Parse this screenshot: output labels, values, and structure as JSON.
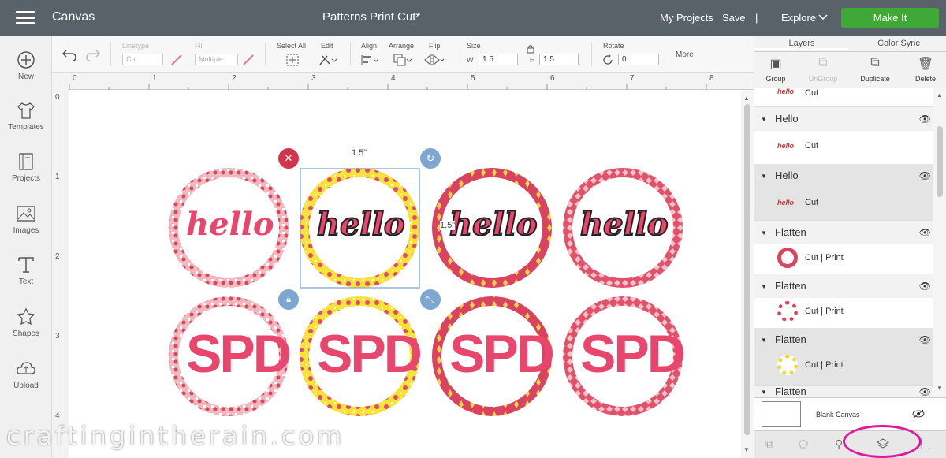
{
  "header": {
    "app_title": "Canvas",
    "doc_title": "Patterns Print Cut*",
    "my_projects": "My Projects",
    "save": "Save",
    "divider": "|",
    "explore": "Explore",
    "make_it": "Make It"
  },
  "leftbar": {
    "items": [
      {
        "label": "New",
        "icon": "plus-circle-icon"
      },
      {
        "label": "Templates",
        "icon": "tshirt-icon"
      },
      {
        "label": "Projects",
        "icon": "projects-icon"
      },
      {
        "label": "Images",
        "icon": "image-icon"
      },
      {
        "label": "Text",
        "icon": "text-icon"
      },
      {
        "label": "Shapes",
        "icon": "shapes-icon"
      },
      {
        "label": "Upload",
        "icon": "upload-icon"
      }
    ]
  },
  "toolbar": {
    "linetype_label": "Linetype",
    "linetype_value": "Cut",
    "fill_label": "Fill",
    "fill_value": "Multiple",
    "select_all": "Select All",
    "edit": "Edit",
    "align": "Align",
    "arrange": "Arrange",
    "flip": "Flip",
    "size": "Size",
    "w_label": "W",
    "w_value": "1.5",
    "h_label": "H",
    "h_value": "1.5",
    "rotate": "Rotate",
    "rotate_value": "0",
    "more": "More"
  },
  "ruler": {
    "h": [
      "0",
      "1",
      "2",
      "3",
      "4",
      "5",
      "6",
      "7",
      "8"
    ],
    "v": [
      "0",
      "1",
      "2",
      "3",
      "4"
    ]
  },
  "canvas": {
    "size_top": "1.5\"",
    "size_side": "1.5\"",
    "top_row_text": "hello",
    "bottom_row_text": "SPD",
    "watermark": "craftingintherain.com"
  },
  "layers_panel": {
    "tab_layers": "Layers",
    "tab_color_sync": "Color Sync",
    "group": "Group",
    "ungroup": "UnGroup",
    "duplicate": "Duplicate",
    "delete": "Delete",
    "partial_top": "Cut",
    "layers": [
      {
        "name": "Hello",
        "sub": "Cut",
        "thumb": "hello"
      },
      {
        "name": "Hello",
        "sub": "Cut",
        "thumb": "hello"
      },
      {
        "name": "Flatten",
        "sub": "Cut  |  Print"
      },
      {
        "name": "Flatten",
        "sub": "Cut  |  Print"
      },
      {
        "name": "Flatten",
        "sub": "Cut  |  Print"
      },
      {
        "name": "Flatten"
      }
    ],
    "blank_canvas": "Blank Canvas"
  },
  "colors": {
    "topbar": "#5a6269",
    "make_it": "#3fa837",
    "pink": "#e8466c",
    "highlight": "#e0199a"
  }
}
